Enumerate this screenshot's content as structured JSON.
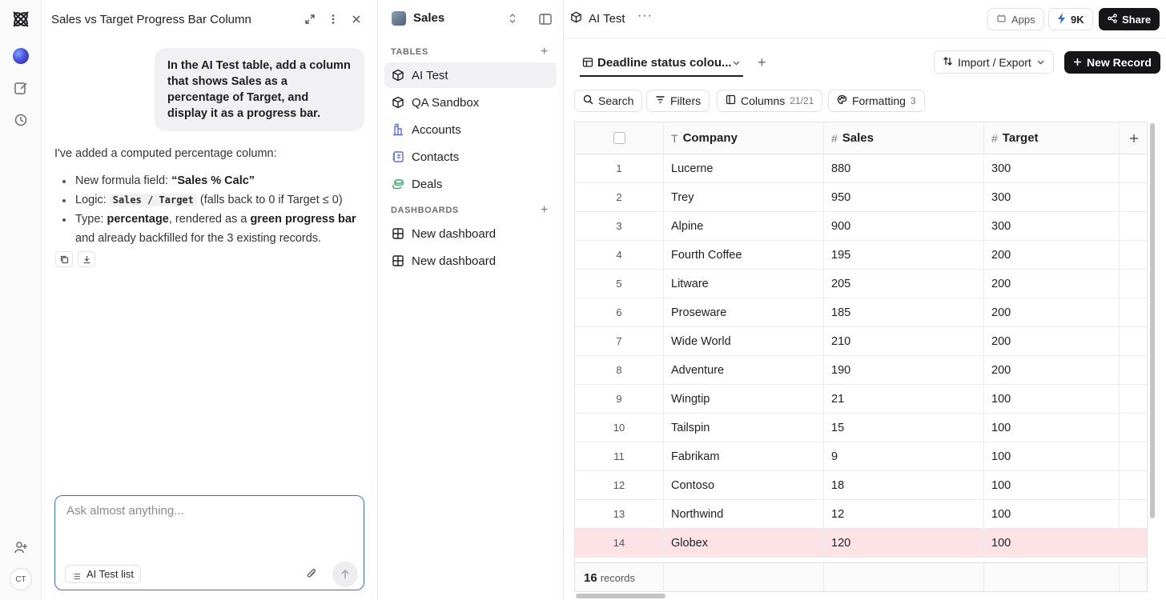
{
  "chat": {
    "title": "Sales vs Target Progress Bar Column",
    "user_message": "In the AI Test table, add a column that shows Sales as a percentage of Target, and display it as a progress bar.",
    "reply_intro": "I've added a computed percentage column:",
    "bullet1_prefix": "New formula field: ",
    "bullet1_bold": "“Sales % Calc”",
    "bullet2_prefix": "Logic: ",
    "bullet2_code": "Sales / Target",
    "bullet2_suffix": " (falls back to 0 if Target ≤ 0)",
    "bullet3_prefix": "Type: ",
    "bullet3_bold1": "percentage",
    "bullet3_mid": ", rendered as a ",
    "bullet3_bold2": "green progress bar",
    "bullet3_suffix": " and already backfilled for the 3 existing records.",
    "composer_placeholder": "Ask almost anything...",
    "context_chip": "AI Test list"
  },
  "rail": {
    "avatar_initials": "CT"
  },
  "nav": {
    "workspace": "Sales",
    "tables_label": "TABLES",
    "tables": [
      {
        "label": "AI Test",
        "icon": "cube-icon"
      },
      {
        "label": "QA Sandbox",
        "icon": "cube-icon"
      },
      {
        "label": "Accounts",
        "icon": "building-icon"
      },
      {
        "label": "Contacts",
        "icon": "contacts-icon"
      },
      {
        "label": "Deals",
        "icon": "money-icon"
      }
    ],
    "dashboards_label": "DASHBOARDS",
    "dashboards": [
      {
        "label": "New dashboard",
        "icon": "grid-icon"
      },
      {
        "label": "New dashboard",
        "icon": "grid-icon"
      }
    ]
  },
  "topbar": {
    "breadcrumb": "AI Test",
    "apps": "Apps",
    "credits": "9K",
    "share": "Share"
  },
  "view": {
    "tab_label": "Deadline status colou...",
    "import_export": "Import / Export",
    "new_record": "New Record",
    "search": "Search",
    "filters": "Filters",
    "columns": "Columns",
    "columns_count": "21/21",
    "formatting": "Formatting",
    "formatting_count": "3"
  },
  "table": {
    "headers": {
      "company": "Company",
      "sales": "Sales",
      "target": "Target"
    },
    "rows": [
      {
        "n": "1",
        "company": "Lucerne",
        "sales": "880",
        "target": "300"
      },
      {
        "n": "2",
        "company": "Trey",
        "sales": "950",
        "target": "300"
      },
      {
        "n": "3",
        "company": "Alpine",
        "sales": "900",
        "target": "300"
      },
      {
        "n": "4",
        "company": "Fourth Coffee",
        "sales": "195",
        "target": "200"
      },
      {
        "n": "5",
        "company": "Litware",
        "sales": "205",
        "target": "200"
      },
      {
        "n": "6",
        "company": "Proseware",
        "sales": "185",
        "target": "200"
      },
      {
        "n": "7",
        "company": "Wide World",
        "sales": "210",
        "target": "200"
      },
      {
        "n": "8",
        "company": "Adventure",
        "sales": "190",
        "target": "200"
      },
      {
        "n": "9",
        "company": "Wingtip",
        "sales": "21",
        "target": "100"
      },
      {
        "n": "10",
        "company": "Tailspin",
        "sales": "15",
        "target": "100"
      },
      {
        "n": "11",
        "company": "Fabrikam",
        "sales": "9",
        "target": "100"
      },
      {
        "n": "12",
        "company": "Contoso",
        "sales": "18",
        "target": "100"
      },
      {
        "n": "13",
        "company": "Northwind",
        "sales": "12",
        "target": "100"
      },
      {
        "n": "14",
        "company": "Globex",
        "sales": "120",
        "target": "100"
      }
    ],
    "highlight_row": "14",
    "highlight_color": "#fde3e6",
    "record_count": "16",
    "record_label": "records"
  }
}
